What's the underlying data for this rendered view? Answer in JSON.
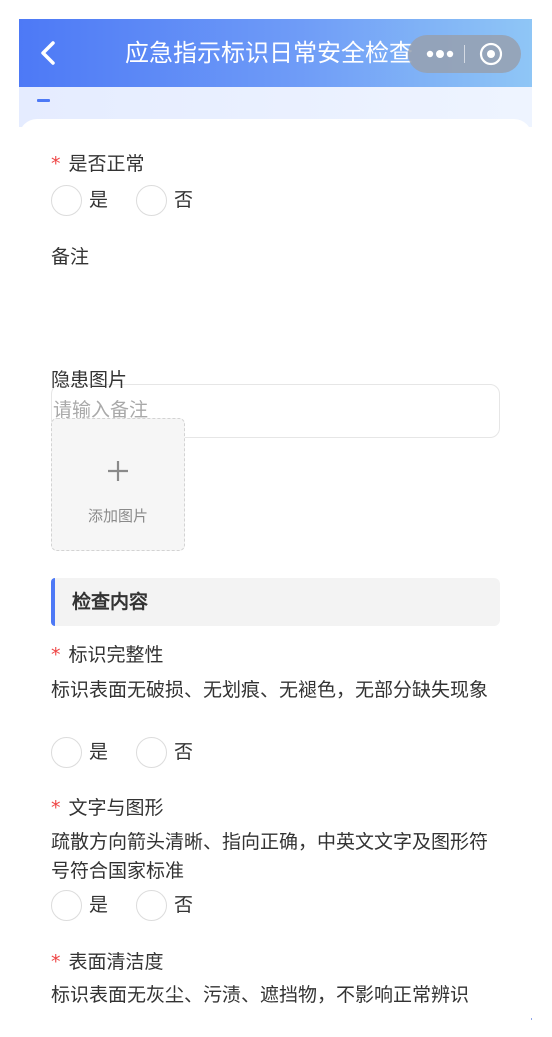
{
  "header": {
    "title": "应急指示标识日常安全检查",
    "back_icon": "chevron-left-icon",
    "capsule": {
      "more_icon": "more-dots-icon",
      "close_icon": "target-close-icon"
    },
    "gradient_start": "#4d79f6",
    "gradient_end": "#8fc6f6"
  },
  "form": {
    "normal": {
      "label": "是否正常",
      "required": "*",
      "yes": "是",
      "no": "否"
    },
    "remark": {
      "label": "备注",
      "placeholder": "请输入备注",
      "value": ""
    },
    "photo": {
      "label": "隐患图片",
      "add_label": "添加图片",
      "add_icon": "plus-icon"
    }
  },
  "section": {
    "title": "检查内容",
    "accent": "#4d79f6"
  },
  "checks": [
    {
      "title": "标识完整性",
      "required": "*",
      "desc": "标识表面无破损、无划痕、无褪色，无部分缺失现象",
      "yes": "是",
      "no": "否"
    },
    {
      "title": "文字与图形",
      "required": "*",
      "desc": "疏散方向箭头清晰、指向正确，中英文文字及图形符号符合国家标准",
      "yes": "是",
      "no": "否"
    },
    {
      "title": "表面清洁度",
      "required": "*",
      "desc": "标识表面无灰尘、污渍、遮挡物，不影响正常辨识",
      "yes": "是",
      "no": "否"
    }
  ]
}
